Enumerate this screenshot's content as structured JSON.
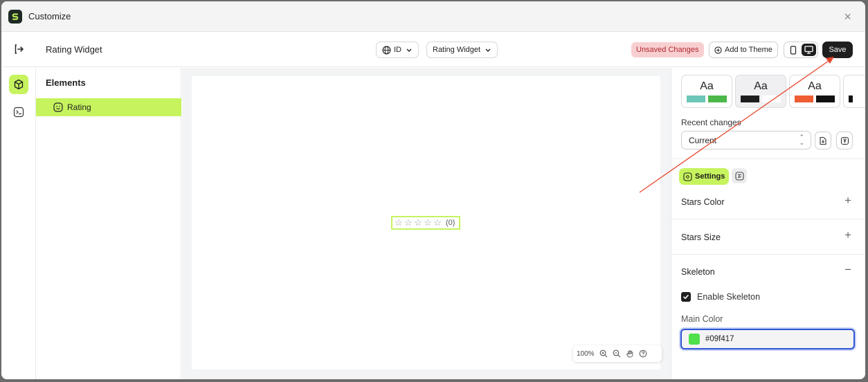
{
  "window": {
    "title": "Customize",
    "close_glyph": "×"
  },
  "topbar": {
    "widget_name": "Rating Widget",
    "lang": {
      "label": "ID",
      "icon": "globe-icon"
    },
    "widget_select": {
      "label": "Rating Widget"
    },
    "unsaved_label": "Unsaved Changes",
    "add_theme_label": "Add to Theme",
    "save_label": "Save"
  },
  "layers": {
    "title": "Elements",
    "items": [
      {
        "label": "Rating",
        "icon": "smile-icon"
      }
    ]
  },
  "canvas": {
    "rating": {
      "stars": [
        "☆",
        "☆",
        "☆",
        "☆",
        "☆"
      ],
      "count": "(0)"
    },
    "zoom_level": "100%"
  },
  "rightpanel": {
    "themes": [
      {
        "label": "Aa",
        "colors": [
          "#6cc7b8",
          "#4cb84a"
        ]
      },
      {
        "label": "Aa",
        "colors": [
          "#1d1d1d",
          "#ffffff"
        ]
      },
      {
        "label": "Aa",
        "colors": [
          "#ee5d33",
          "#111111"
        ]
      },
      {
        "label": "",
        "colors": [
          "#111111"
        ]
      }
    ],
    "recent_label": "Recent changes",
    "recent_value": "Current",
    "settings_tab": "Settings",
    "sections": [
      {
        "title": "Stars Color",
        "toggle": "+"
      },
      {
        "title": "Stars Size",
        "toggle": "+"
      },
      {
        "title": "Skeleton",
        "toggle": "−"
      }
    ],
    "enable_skeleton_label": "Enable Skeleton",
    "main_color_label": "Main Color",
    "main_color_value": "#09f417"
  },
  "colors": {
    "accent": "#c6f35e",
    "annotation_arrow": "#e8452c"
  }
}
